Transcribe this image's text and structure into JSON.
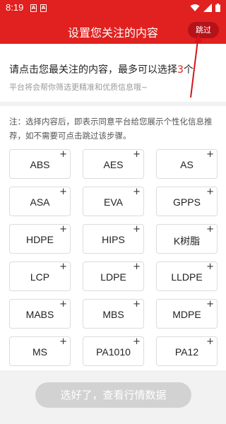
{
  "status_bar": {
    "time": "8:19",
    "notif_glyph": "A"
  },
  "header": {
    "title": "设置您关注的内容",
    "skip_label": "跳过"
  },
  "intro": {
    "headline_prefix": "请点击您最关注的内容，最多可以选择",
    "headline_count": "3",
    "headline_suffix": "个",
    "subtitle": "平台将会帮你筛选更精准和优质信息哦~"
  },
  "note": "注：选择内容后，即表示同意平台给您展示个性化信息推荐，如不需要可点击跳过该步骤。",
  "chips": [
    {
      "label": "ABS"
    },
    {
      "label": "AES"
    },
    {
      "label": "AS"
    },
    {
      "label": "ASA"
    },
    {
      "label": "EVA"
    },
    {
      "label": "GPPS"
    },
    {
      "label": "HDPE"
    },
    {
      "label": "HIPS"
    },
    {
      "label": "K树脂"
    },
    {
      "label": "LCP"
    },
    {
      "label": "LDPE"
    },
    {
      "label": "LLDPE"
    },
    {
      "label": "MABS"
    },
    {
      "label": "MBS"
    },
    {
      "label": "MDPE"
    },
    {
      "label": "MS"
    },
    {
      "label": "PA1010"
    },
    {
      "label": "PA12"
    }
  ],
  "chip_plus": "+",
  "footer": {
    "confirm_label": "选好了，查看行情数据"
  },
  "colors": {
    "brand": "#e0211f",
    "disabled": "#d2d2d2"
  }
}
